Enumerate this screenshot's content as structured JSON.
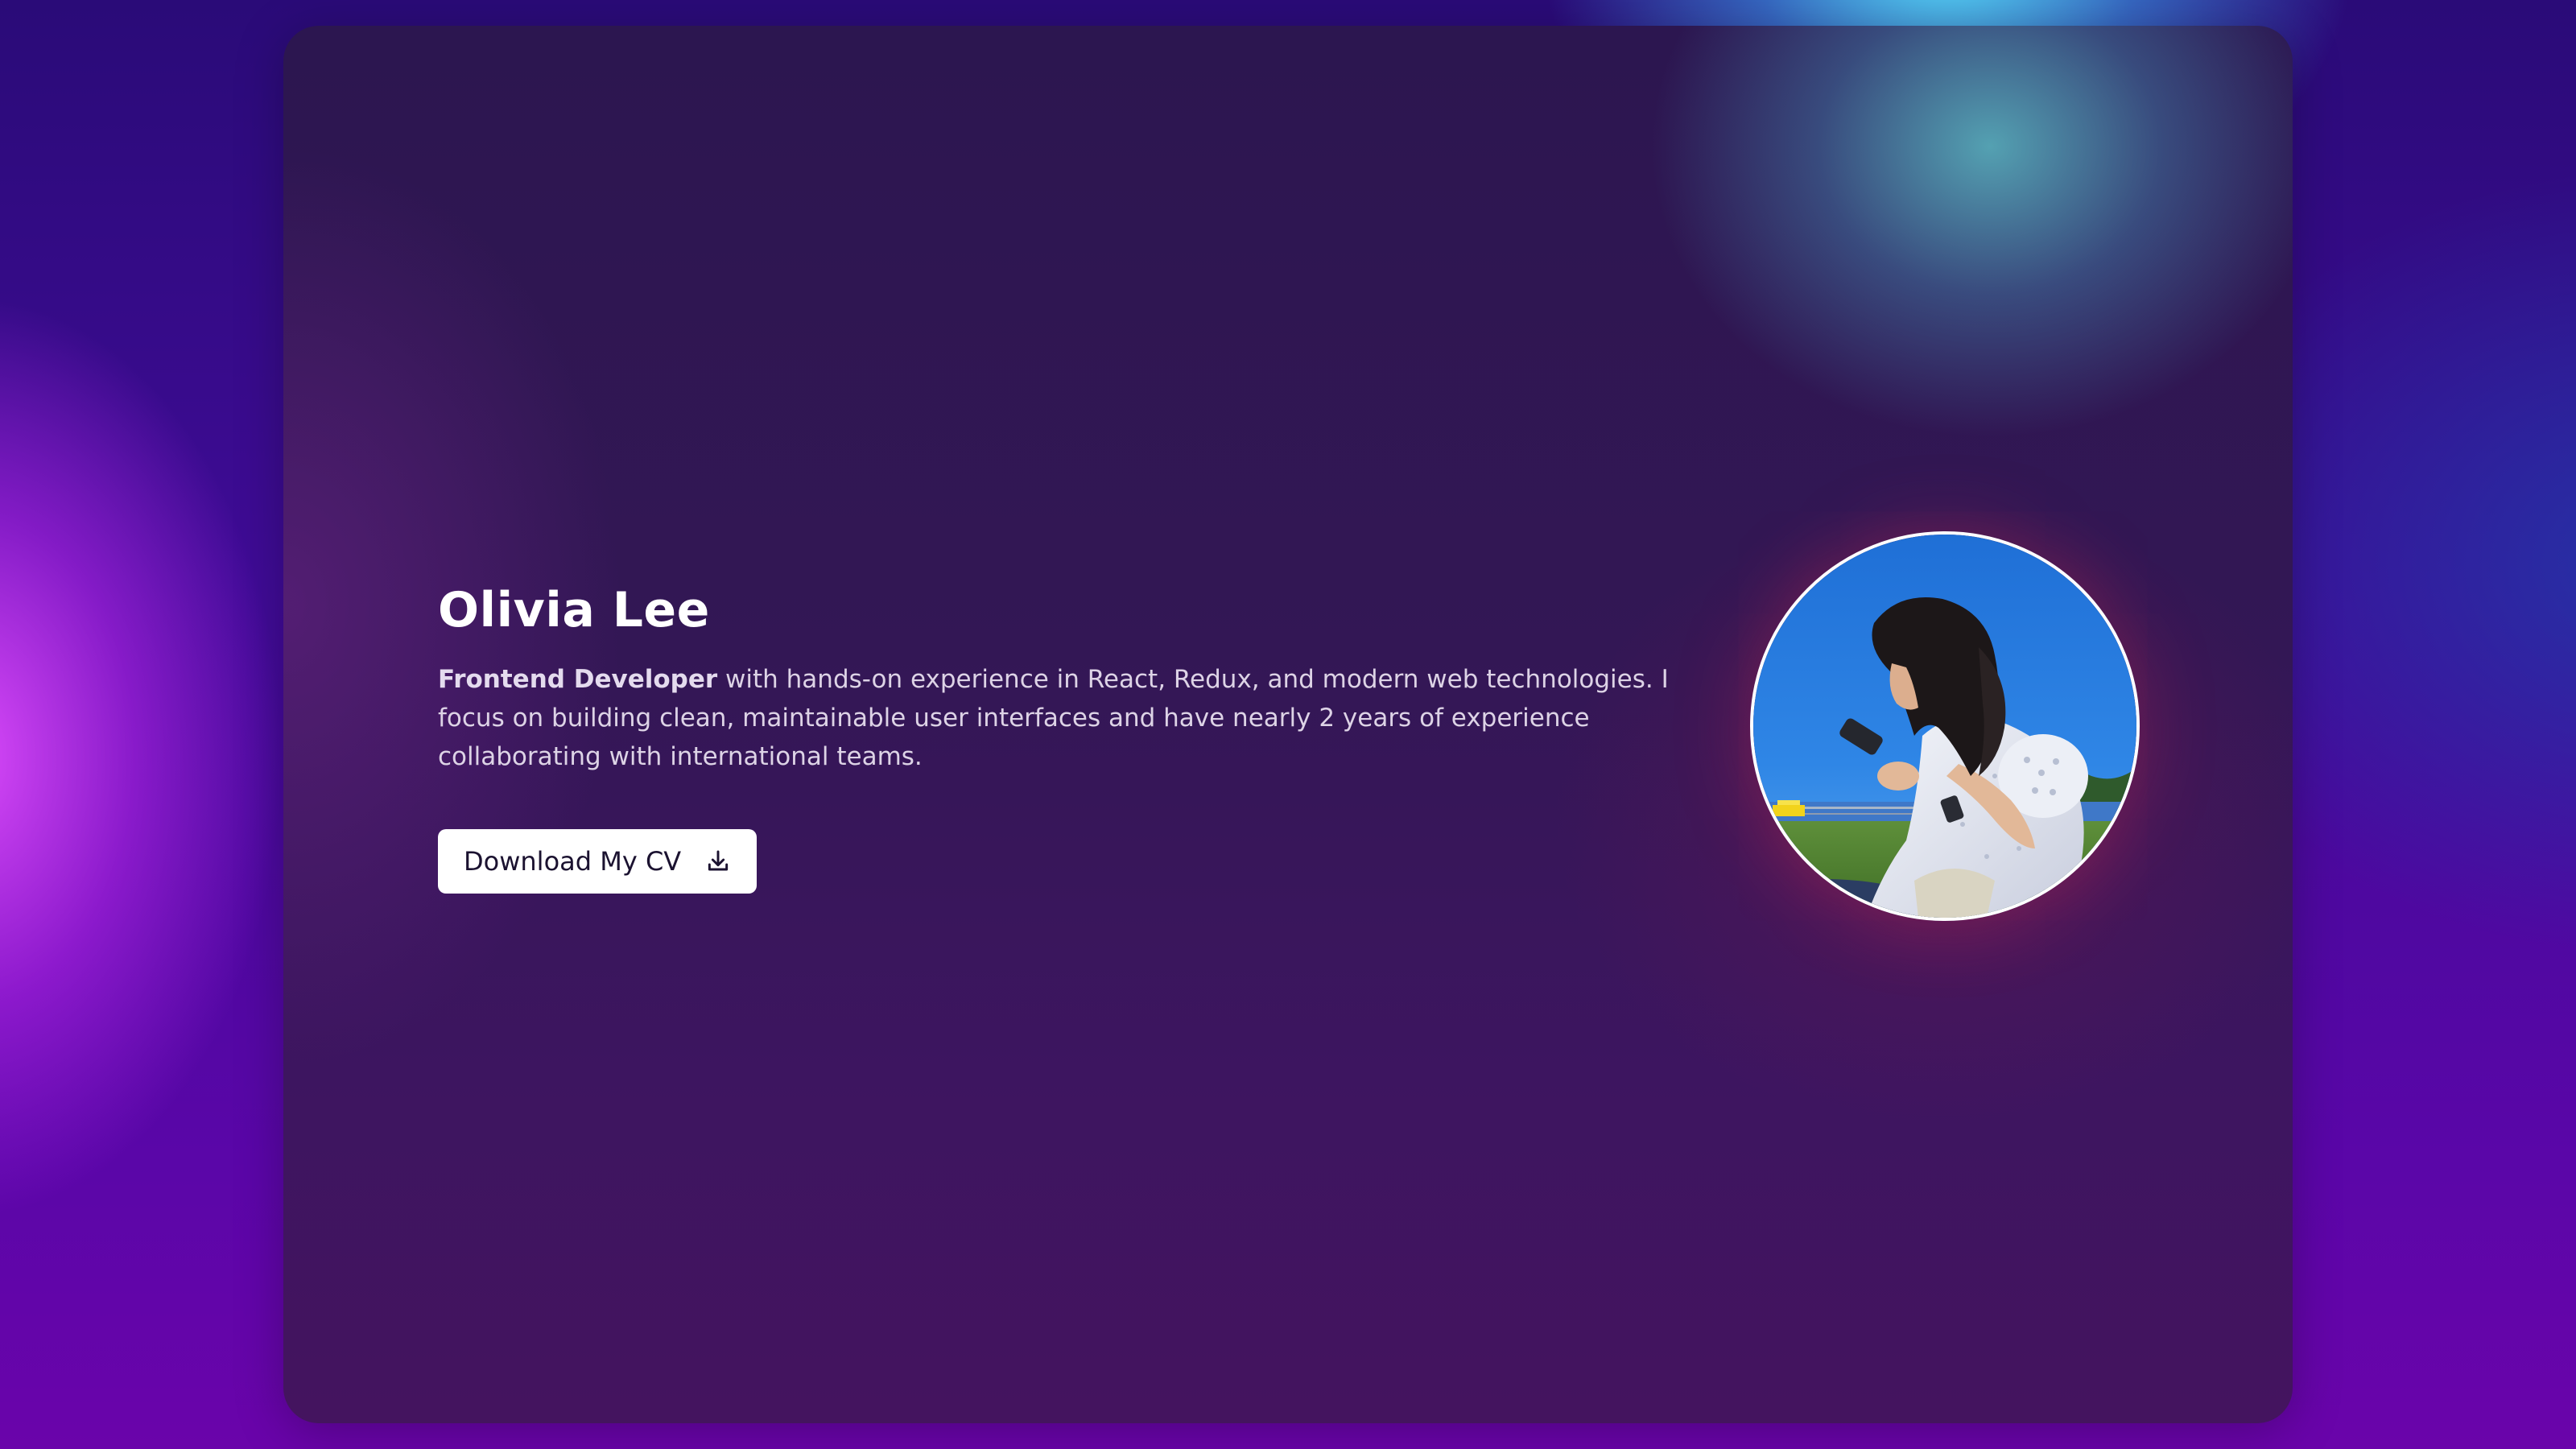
{
  "profile": {
    "name": "Olivia Lee",
    "role": "Frontend Developer",
    "bio": " with hands-on experience in React, Redux, and modern web technologies. I focus on building clean, maintainable user interfaces and have nearly 2 years of experience collaborating with international teams."
  },
  "cta": {
    "download_label": "Download My CV",
    "icon": "download-icon"
  },
  "avatar": {
    "icon": "profile-photo"
  },
  "colors": {
    "accent_pink": "#e24eff",
    "accent_cyan": "#5ae6ff",
    "card_bg": "#2c1650",
    "button_bg": "#ffffff"
  }
}
